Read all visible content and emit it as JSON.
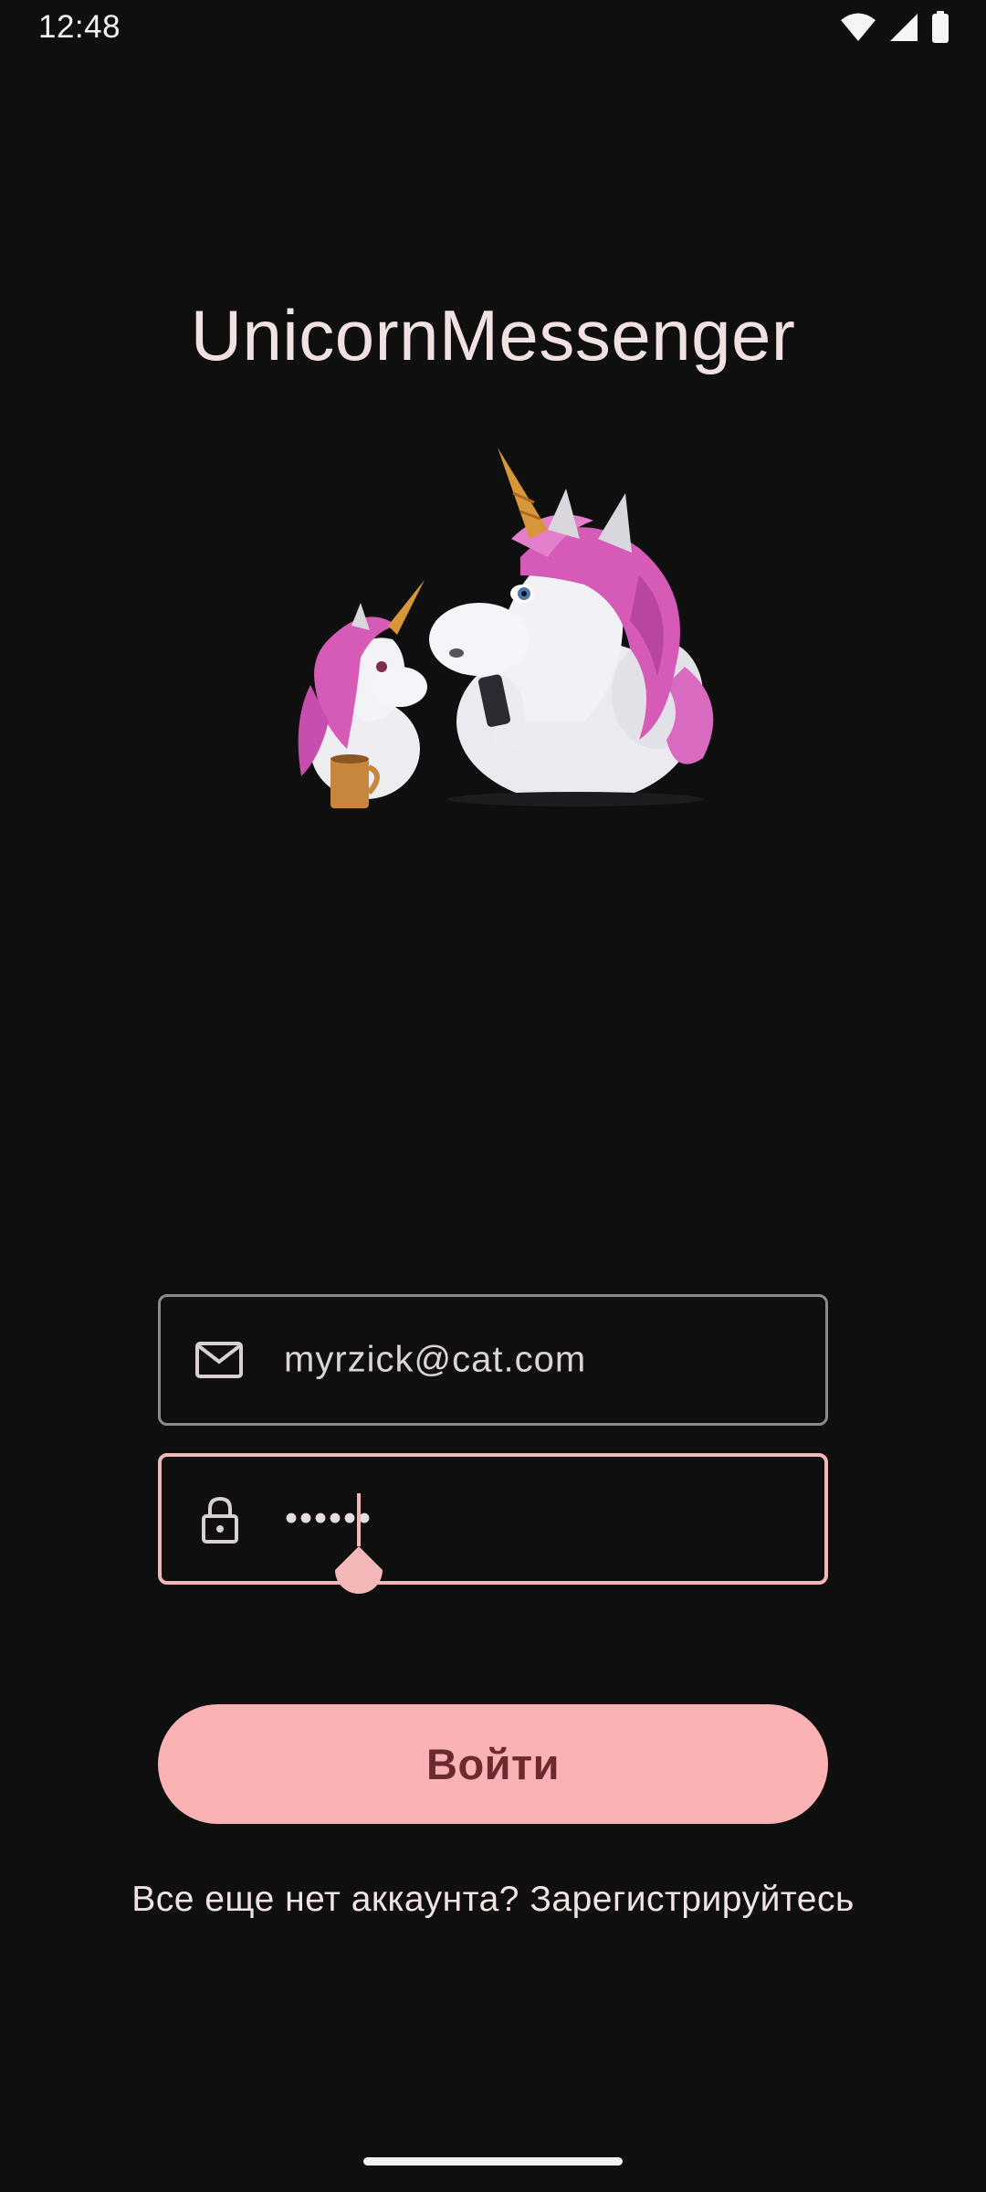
{
  "status_bar": {
    "time": "12:48",
    "icons": [
      "wifi-icon",
      "signal-icon",
      "battery-icon"
    ]
  },
  "app": {
    "title": "UnicornMessenger"
  },
  "login_form": {
    "email": {
      "icon": "mail-icon",
      "value": "myrzick@cat.com"
    },
    "password": {
      "icon": "lock-icon",
      "value": "••••••"
    },
    "submit_label": "Войти",
    "register_prompt": "Все еще нет аккаунта? Зарегистрируйтесь"
  },
  "colors": {
    "background": "#0f0f10",
    "accent": "#fbb2b5",
    "focused_border": "#f4b7b8",
    "button_text": "#6b2a2f"
  }
}
